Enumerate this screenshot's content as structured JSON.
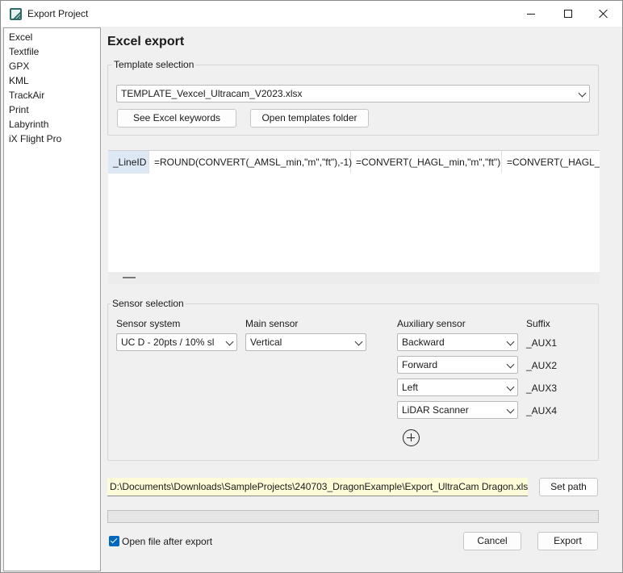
{
  "window": {
    "title": "Export Project",
    "icon": "app-logo-icon"
  },
  "formats": [
    "Excel",
    "Textfile",
    "GPX",
    "KML",
    "TrackAir",
    "Print",
    "Labyrinth",
    "iX Flight Pro"
  ],
  "main": {
    "heading": "Excel export"
  },
  "template": {
    "legend": "Template selection",
    "selected": "TEMPLATE_Vexcel_Ultracam_V2023.xlsx",
    "keywords_button": "See Excel keywords",
    "folder_button": "Open templates folder"
  },
  "grid": {
    "cells": [
      "_LineID",
      "=ROUND(CONVERT(_AMSL_min,\"m\",\"ft\"),-1)",
      "=CONVERT(_HAGL_min,\"m\",\"ft\")",
      "=CONVERT(_HAGL_m"
    ]
  },
  "sensor": {
    "legend": "Sensor selection",
    "system_label": "Sensor system",
    "system_value": "UC D - 20pts / 10% sl",
    "main_label": "Main sensor",
    "main_value": "Vertical",
    "aux_label": "Auxiliary sensor",
    "suffix_label": "Suffix",
    "aux": [
      {
        "value": "Backward",
        "suffix": "_AUX1"
      },
      {
        "value": "Forward",
        "suffix": "_AUX2"
      },
      {
        "value": "Left",
        "suffix": "_AUX3"
      },
      {
        "value": "LiDAR Scanner",
        "suffix": "_AUX4"
      }
    ]
  },
  "output": {
    "path": "D:\\Documents\\Downloads\\SampleProjects\\240703_DragonExample\\Export_UltraCam Dragon.xlsx",
    "set_path_button": "Set path",
    "open_after_export_label": "Open file after export",
    "open_after_export_checked": true,
    "progress_percent": 0
  },
  "footer": {
    "cancel": "Cancel",
    "export": "Export"
  },
  "colors": {
    "path_background": "#fefcd8",
    "checkbox_accent": "#0067c0",
    "selected_cell": "#dde8f5"
  }
}
